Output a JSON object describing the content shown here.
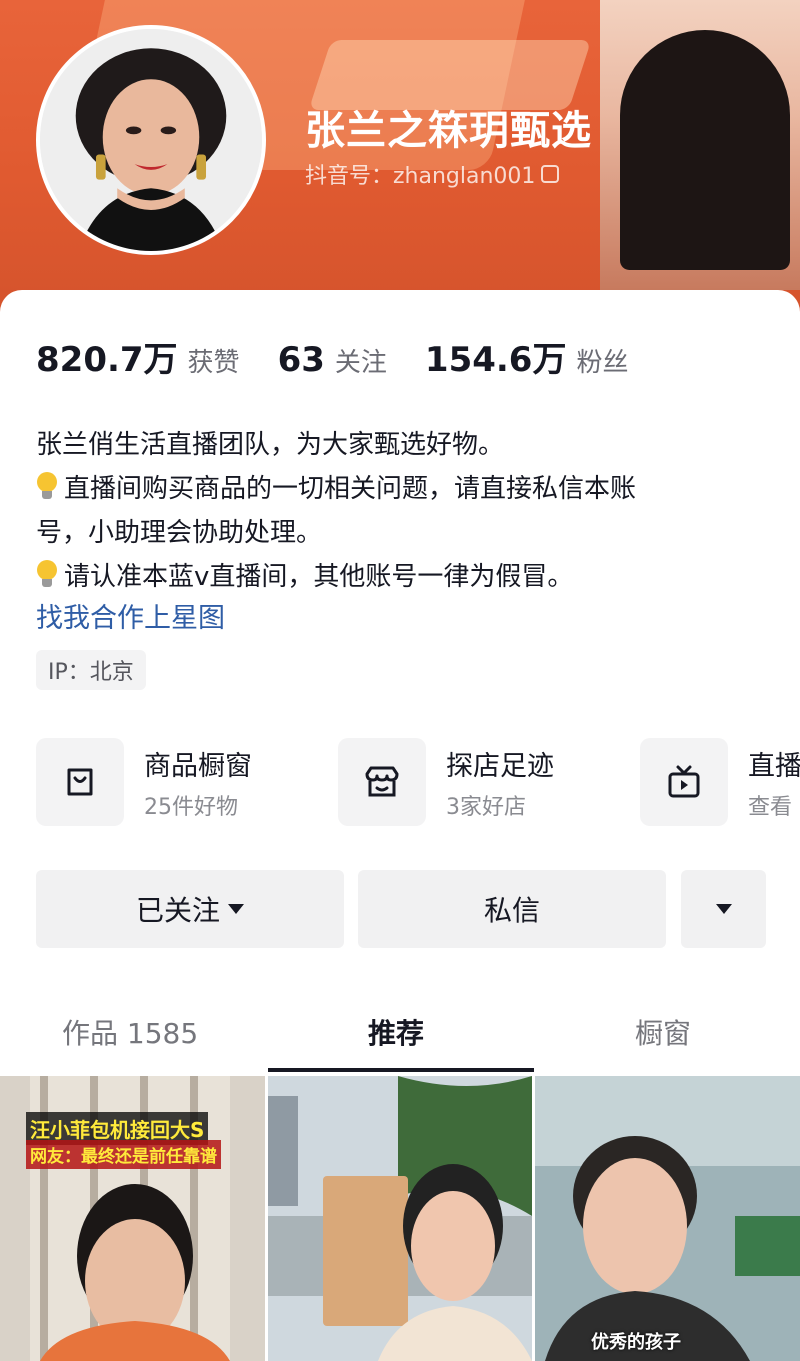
{
  "profile": {
    "name": "张兰之箖玥甄选",
    "douyin_id": "抖音号：zhanglan001"
  },
  "stats": [
    {
      "value": "820.7万",
      "label": "获赞"
    },
    {
      "value": "63",
      "label": "关注"
    },
    {
      "value": "154.6万",
      "label": "粉丝"
    }
  ],
  "bio": {
    "line1": "张兰俏生活直播团队，为大家甄选好物。",
    "line2": "直播间购买商品的一切相关问题，请直接私信本账",
    "line3": "号，小助理会协助处理。",
    "line4": "请认准本蓝v直播间，其他账号一律为假冒。"
  },
  "star_link": "找我合作上星图",
  "ip_tag": "IP：北京",
  "features": [
    {
      "title": "商品橱窗",
      "sub": "25件好物",
      "icon": "bag-icon"
    },
    {
      "title": "探店足迹",
      "sub": "3家好店",
      "icon": "store-icon"
    },
    {
      "title": "直播",
      "sub": "查看",
      "icon": "tv-icon"
    }
  ],
  "actions": {
    "follow": "已关注",
    "message": "私信"
  },
  "tabs": [
    {
      "label": "作品 1585"
    },
    {
      "label": "推荐"
    },
    {
      "label": "橱窗"
    }
  ],
  "videos": [
    {
      "caption1": "汪小菲包机接回大S",
      "caption2": "网友：最终还是前任靠谱"
    },
    {},
    {
      "caption": "优秀的孩子"
    }
  ]
}
